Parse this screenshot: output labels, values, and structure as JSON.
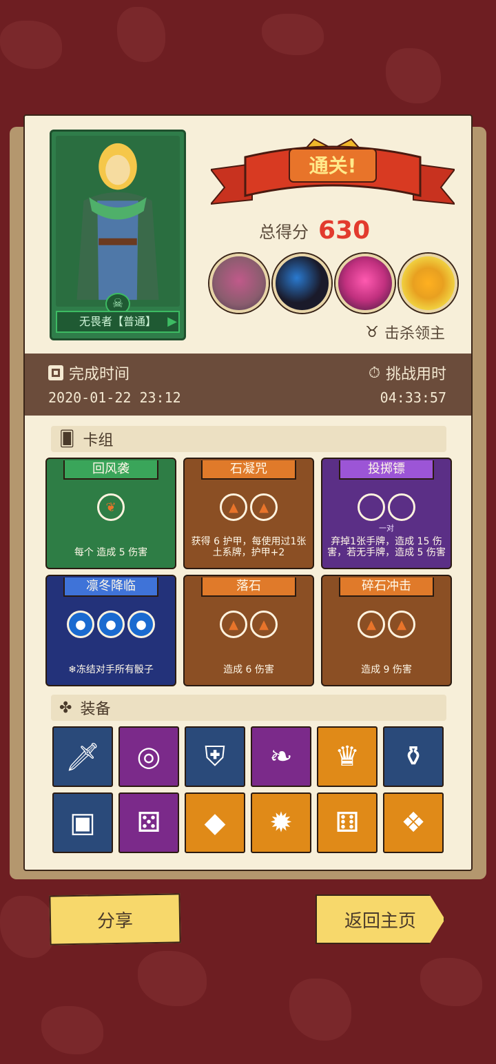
{
  "hero": {
    "name": "无畏者【普通】",
    "icon": "skull-icon"
  },
  "result": {
    "banner": "通关!",
    "score_label": "总得分",
    "score": "630"
  },
  "bosses": {
    "label": "击杀领主",
    "colors": [
      "#8a5c6e",
      "#1a1a2a",
      "#c0307e",
      "#e8a020"
    ]
  },
  "info": {
    "finish_label": "完成时间",
    "finish_value": "2020-01-22 23:12",
    "duration_label": "挑战用时",
    "duration_value": "04:33:57"
  },
  "deck": {
    "title": "卡组",
    "cards": [
      {
        "title": "回风袭",
        "desc": "每个  造成 5 伤害",
        "color": "#2e7d45",
        "hdr": "#3aa55a",
        "dice": 1,
        "die_color": "#2e7d45",
        "die_icon": "❦"
      },
      {
        "title": "石凝咒",
        "desc": "获得 6 护甲，每使用过1张土系牌，护甲+2",
        "color": "#8b4f24",
        "hdr": "#e07a2a",
        "dice": 2,
        "die_color": "#8b4f24",
        "die_icon": "▲"
      },
      {
        "title": "投掷镖",
        "sub": "一对",
        "desc": "弃掉1张手牌，造成 15 伤害，若无手牌，造成 5 伤害",
        "color": "#5b2f86",
        "hdr": "#9c55d6",
        "dice": 2,
        "die_color": "#5b2f86",
        "die_icon": ""
      },
      {
        "title": "凛冬降临",
        "desc": "❄冻结对手所有骰子",
        "color": "#23327a",
        "hdr": "#3f73d8",
        "dice": 3,
        "die_color": "#1a6ad0",
        "die_icon": "●"
      },
      {
        "title": "落石",
        "desc": "造成 6 伤害",
        "color": "#8b4f24",
        "hdr": "#e07a2a",
        "dice": 2,
        "die_color": "#8b4f24",
        "die_icon": "▲"
      },
      {
        "title": "碎石冲击",
        "desc": "造成 9 伤害",
        "color": "#8b4f24",
        "hdr": "#e07a2a",
        "dice": 2,
        "die_color": "#8b4f24",
        "die_icon": "▲"
      }
    ]
  },
  "equipment": {
    "title": "装备",
    "items": [
      {
        "icon": "dagger-icon",
        "glyph": "🗡",
        "bg": "#2a4a7a"
      },
      {
        "icon": "ring-icon",
        "glyph": "◎",
        "bg": "#7b2a8a"
      },
      {
        "icon": "shield-icon",
        "glyph": "⛨",
        "bg": "#2a4a7a"
      },
      {
        "icon": "leaf-icon",
        "glyph": "❧",
        "bg": "#7b2a8a"
      },
      {
        "icon": "crown-icon",
        "glyph": "♛",
        "bg": "#e08a18"
      },
      {
        "icon": "jar-icon",
        "glyph": "⚱",
        "bg": "#2a4a7a"
      },
      {
        "icon": "chest-icon",
        "glyph": "▣",
        "bg": "#2a4a7a"
      },
      {
        "icon": "dice-icon",
        "glyph": "⚄",
        "bg": "#7b2a8a"
      },
      {
        "icon": "gem-icon",
        "glyph": "◆",
        "bg": "#e08a18"
      },
      {
        "icon": "spike-ball-icon",
        "glyph": "✹",
        "bg": "#e08a18"
      },
      {
        "icon": "fire-dice-icon",
        "glyph": "⚅",
        "bg": "#e08a18"
      },
      {
        "icon": "crystal-icon",
        "glyph": "❖",
        "bg": "#e08a18"
      }
    ]
  },
  "buttons": {
    "share": "分享",
    "home": "返回主页"
  }
}
